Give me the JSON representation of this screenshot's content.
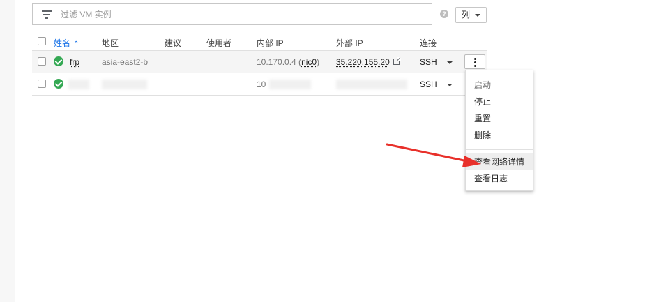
{
  "filter": {
    "placeholder": "过滤 VM 实例"
  },
  "toolbar": {
    "columns_label": "列"
  },
  "table": {
    "headers": {
      "name": "姓名",
      "zone": "地区",
      "recommendation": "建议",
      "used_by": "使用者",
      "internal_ip": "内部 IP",
      "external_ip": "外部 IP",
      "connect": "连接"
    },
    "rows": [
      {
        "name": "frp",
        "zone": "asia-east2-b",
        "internal_ip": "10.170.0.4 (",
        "internal_nic": "nic0",
        "internal_close": ")",
        "external_ip": "35.220.155.20",
        "connect": "SSH",
        "status": "running"
      },
      {
        "internal_ip": "10",
        "connect": "SSH",
        "status": "running"
      }
    ]
  },
  "menu": {
    "items": [
      "启动",
      "停止",
      "重置",
      "删除",
      "查看网络详情",
      "查看日志"
    ]
  },
  "colors": {
    "accent": "#1a73e8",
    "status_ok": "#34a853",
    "annotation_arrow": "#e8302a"
  }
}
